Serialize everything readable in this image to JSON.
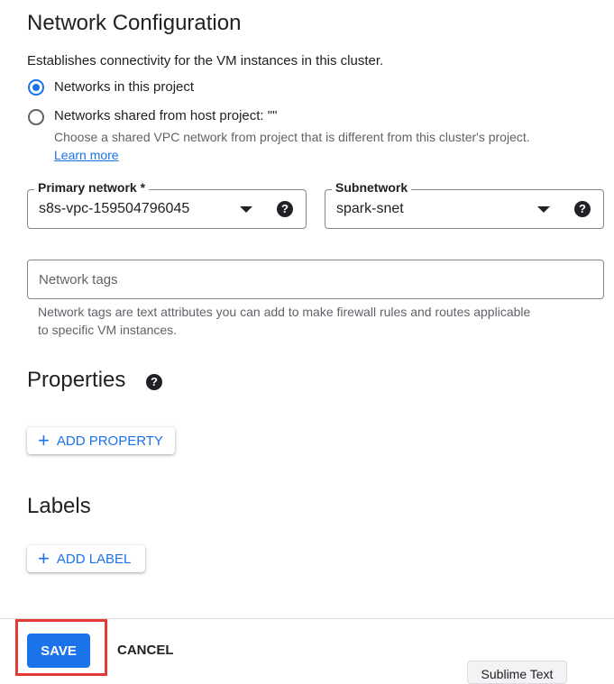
{
  "network": {
    "title": "Network Configuration",
    "description": "Establishes connectivity for the VM instances in this cluster.",
    "options": [
      {
        "label": "Networks in this project",
        "selected": true
      },
      {
        "label": "Networks shared from host project: \"\"",
        "selected": false
      }
    ],
    "shared_help": "Choose a shared VPC network from project that is different from this cluster's project.",
    "learn_more": "Learn more",
    "primary": {
      "label": "Primary network *",
      "value": "s8s-vpc-159504796045",
      "help_icon": "help-icon"
    },
    "subnetwork": {
      "label": "Subnetwork",
      "value": "spark-snet",
      "help_icon": "help-icon"
    },
    "tags": {
      "placeholder": "Network tags",
      "help_line1": "Network tags are text attributes you can add to make firewall rules and routes applicable",
      "help_line2": "to specific VM instances."
    }
  },
  "properties": {
    "title": "Properties",
    "add_label": "ADD PROPERTY",
    "help_icon": "help-icon"
  },
  "labels": {
    "title": "Labels",
    "add_label": "ADD LABEL"
  },
  "footer": {
    "save": "SAVE",
    "cancel": "CANCEL"
  },
  "tooltip": {
    "text": "Sublime Text"
  },
  "colors": {
    "accent": "#1a73e8",
    "highlight": "#e53935"
  }
}
